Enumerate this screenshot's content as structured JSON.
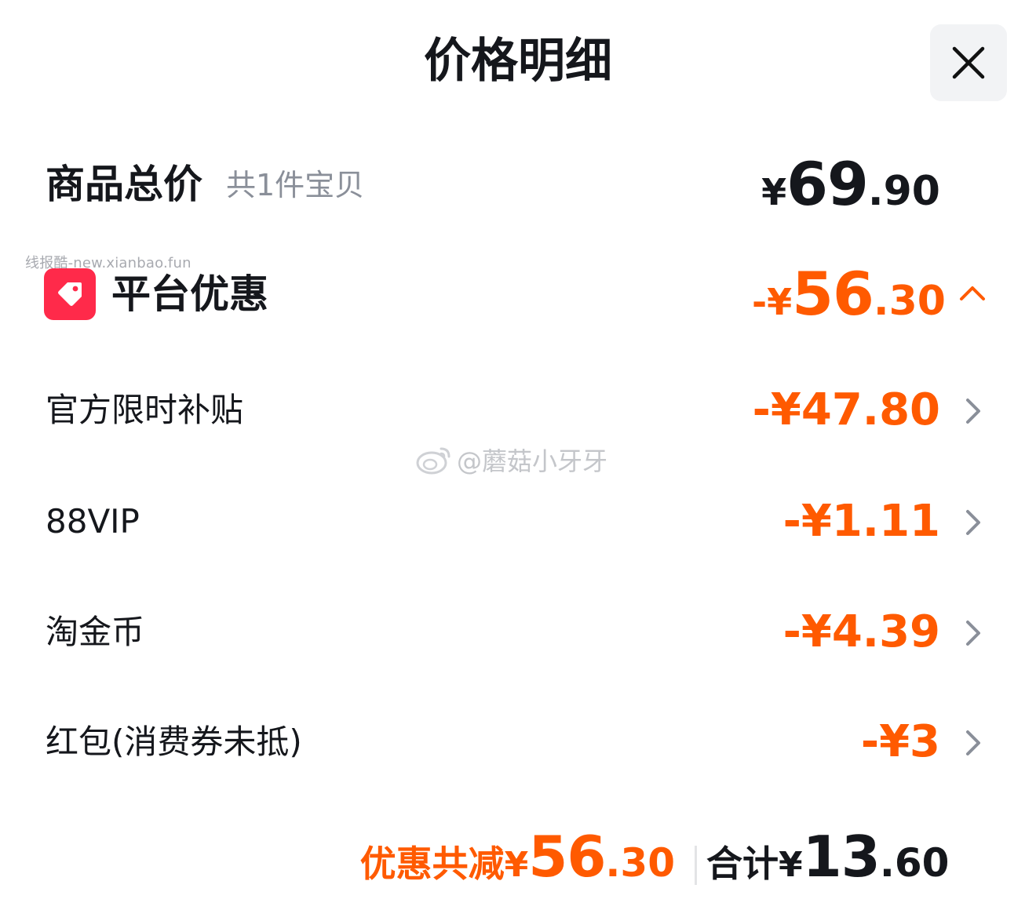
{
  "header": {
    "title": "价格明细",
    "close_icon": "close-icon"
  },
  "goods_total": {
    "label": "商品总价",
    "count_text": "共1件宝贝",
    "currency": "¥",
    "amount_int": "69",
    "amount_dec": ".90"
  },
  "watermark": {
    "site_text": "线报酷-new.xianbao.fun",
    "weibo_handle": "@蘑菇小牙牙"
  },
  "platform_discount": {
    "icon": "tag-icon",
    "label": "平台优惠",
    "amount_prefix": "-¥",
    "amount_int": "56",
    "amount_dec": ".30",
    "expanded": true
  },
  "discount_items": [
    {
      "label": "官方限时补贴",
      "amount": "-¥47.80"
    },
    {
      "label": "88VIP",
      "amount": "-¥1.11"
    },
    {
      "label": "淘金币",
      "amount": "-¥4.39"
    },
    {
      "label": "红包(消费券未抵)",
      "amount": "-¥3"
    }
  ],
  "footer": {
    "saved_label": "优惠共减",
    "saved_currency": "¥",
    "saved_int": "56",
    "saved_dec": ".30",
    "total_label": "合计",
    "total_currency": "¥",
    "total_int": "13",
    "total_dec": ".60"
  },
  "colors": {
    "accent": "#ff5a00",
    "tag_bg": "#ff2a4a",
    "text": "#15171c",
    "muted": "#8a8f99"
  }
}
